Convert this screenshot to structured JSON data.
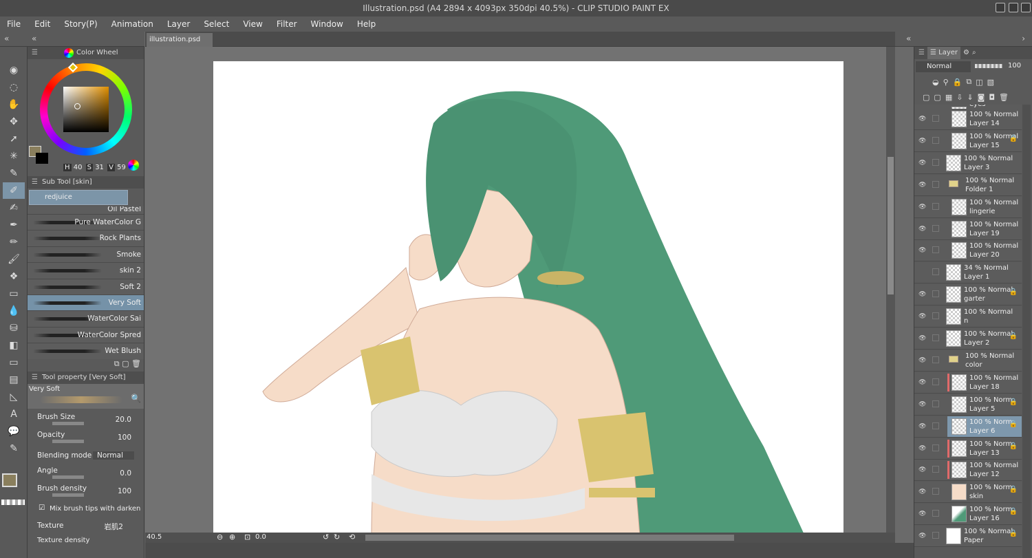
{
  "window": {
    "title": "Illustration.psd (A4 2894 x 4093px 350dpi 40.5%) - CLIP STUDIO PAINT EX"
  },
  "menu": [
    "File",
    "Edit",
    "Story(P)",
    "Animation",
    "Layer",
    "Select",
    "View",
    "Filter",
    "Window",
    "Help"
  ],
  "doc_tab": {
    "label": "illustration.psd",
    "close": "✖"
  },
  "color_panel": {
    "tab": "Color Wheel",
    "h_label": "H",
    "h": "40",
    "s_label": "S",
    "s": "31",
    "v_label": "V",
    "v": "59"
  },
  "subtool": {
    "header": "Sub Tool [skin]",
    "group": "redjuice",
    "brushes": [
      "Oil Pastel",
      "Pure WaterColor G",
      "Rock Plants",
      "Smoke",
      "skin 2",
      "Soft 2",
      "Very Soft",
      "WaterColor Sai",
      "WaterColor Spred",
      "Wet Blush"
    ],
    "selected": "Very Soft"
  },
  "tool_property": {
    "header": "Tool property [Very Soft]",
    "preview_name": "Very Soft",
    "brush_size_label": "Brush Size",
    "brush_size": "20.0",
    "opacity_label": "Opacity",
    "opacity": "100",
    "blending_label": "Blending mode",
    "blending": "Normal",
    "angle_label": "Angle",
    "angle": "0.0",
    "density_label": "Brush density",
    "density": "100",
    "mix_label": "Mix brush tips with darken",
    "texture_label": "Texture",
    "texture": "岩肌2",
    "texture_density_label": "Texture density"
  },
  "canvas": {
    "zoom": "40.5",
    "rotate": "0.0"
  },
  "layer_panel": {
    "tab": "Layer",
    "blend": "Normal",
    "opacity": "100",
    "layers": [
      {
        "line1": "",
        "line2": "eyes",
        "thumb": "checker",
        "indent": 1,
        "eye": false
      },
      {
        "line1": "100 % Normal",
        "line2": "Layer 14",
        "thumb": "checker",
        "indent": 1,
        "eye": true
      },
      {
        "line1": "100 % Normal",
        "line2": "Layer 15",
        "thumb": "checker",
        "indent": 1,
        "eye": true,
        "lock": true
      },
      {
        "line1": "100 % Normal",
        "line2": "Layer 3",
        "thumb": "checker",
        "indent": 0,
        "eye": true
      },
      {
        "line1": "100 % Normal",
        "line2": "Folder 1",
        "thumb": "folder",
        "indent": 0,
        "eye": true
      },
      {
        "line1": "100 % Normal",
        "line2": "lingerie",
        "thumb": "checker",
        "indent": 1,
        "eye": true
      },
      {
        "line1": "100 % Normal",
        "line2": "Layer 19",
        "thumb": "checker",
        "indent": 1,
        "eye": true
      },
      {
        "line1": "100 % Normal",
        "line2": "Layer 20",
        "thumb": "checker",
        "indent": 1,
        "eye": true
      },
      {
        "line1": "34 % Normal",
        "line2": "Layer 1",
        "thumb": "checker",
        "indent": 0,
        "eye": false
      },
      {
        "line1": "100 % Normal",
        "line2": "garter",
        "thumb": "checker",
        "indent": 0,
        "eye": true,
        "lock": true
      },
      {
        "line1": "100 % Normal",
        "line2": "n",
        "thumb": "checker",
        "indent": 0,
        "eye": true
      },
      {
        "line1": "100 % Normal",
        "line2": "Layer 2",
        "thumb": "checker",
        "indent": 0,
        "eye": true,
        "lock": true
      },
      {
        "line1": "100 % Normal",
        "line2": "color",
        "thumb": "folder",
        "indent": 0,
        "eye": true
      },
      {
        "line1": "100 % Normal",
        "line2": "Layer 18",
        "thumb": "checker",
        "indent": 1,
        "eye": true,
        "clip": true
      },
      {
        "line1": "100 % Norm",
        "line2": "Layer 5",
        "thumb": "checker",
        "indent": 1,
        "eye": true,
        "lock": true
      },
      {
        "line1": "100 % Norm",
        "line2": "Layer 6",
        "thumb": "checker",
        "indent": 1,
        "eye": true,
        "lock": true,
        "selected": true
      },
      {
        "line1": "100 % Norm",
        "line2": "Layer 13",
        "thumb": "checker",
        "indent": 1,
        "eye": true,
        "lock": true,
        "clip": true
      },
      {
        "line1": "100 % Normal",
        "line2": "Layer 12",
        "thumb": "checker",
        "indent": 1,
        "eye": true,
        "clip": true
      },
      {
        "line1": "100 % Norm",
        "line2": "skin",
        "thumb": "skin",
        "indent": 1,
        "eye": true,
        "lock": true
      },
      {
        "line1": "100 % Norm",
        "line2": "Layer 16",
        "thumb": "hair",
        "indent": 1,
        "eye": true,
        "lock": true
      },
      {
        "line1": "100 % Normal",
        "line2": "Paper",
        "thumb": "white",
        "indent": 0,
        "eye": true,
        "lock": true
      }
    ]
  },
  "colors": {
    "hair": "#4f9a78",
    "skin": "#f6dcc8",
    "gold": "#d9c36f",
    "bra": "#e7e7e7",
    "selection": "#7e98ad",
    "main_color": "#8a7f5d"
  }
}
